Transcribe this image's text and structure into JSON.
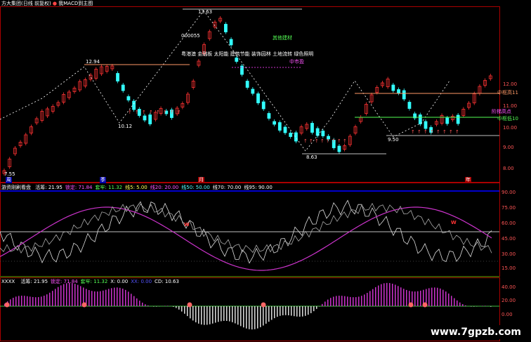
{
  "title_bar": {
    "main_title": "方大集团(日线 前复权)",
    "indicator_title": "我MACD到主图"
  },
  "main_chart": {
    "price_labels": {
      "high_label": "13.63",
      "left_high": "12.94",
      "low_left": "10.12",
      "low_mid": "8.63",
      "low_right": "9.50",
      "min_left": "7.55",
      "code_label": "000055"
    },
    "annotations": {
      "sector_name": "其他建材",
      "concepts": "粤港澳 金融板 太阳能 建筑节能 装饰园林 土地流转 绿色照明",
      "center_line": "中市盈",
      "right_top": "中枢高11",
      "right_mid": "中枢低10",
      "right_pink": "阶梯高点"
    },
    "y_axis": [
      "12.00",
      "11.00",
      "10.00",
      "9.00",
      "8.00"
    ],
    "bottom_markers": [
      "周",
      "季",
      "月",
      "年"
    ]
  },
  "mid_panel": {
    "name": "游资刚刷看盘",
    "items": [
      {
        "label": "活筹: 21.95",
        "color": "#ffffff"
      },
      {
        "label": "锁定: 71.84",
        "color": "#ff55ff"
      },
      {
        "label": "套牢: 11.32",
        "color": "#55ff55"
      },
      {
        "label": "线5: 5.00",
        "color": "#ffff55"
      },
      {
        "label": "线20: 20.00",
        "color": "#ff55ff"
      },
      {
        "label": "线50: 50.00",
        "color": "#55ffff"
      },
      {
        "label": "线70: 70.00",
        "color": "#ffffff"
      },
      {
        "label": "线95: 90.00",
        "color": "#ffffff"
      }
    ],
    "y_axis": [
      "90.00",
      "75.00",
      "60.00",
      "45.00",
      "30.00",
      "15.00"
    ],
    "mark": "W"
  },
  "bottom_panel": {
    "name": "XXXX",
    "items": [
      {
        "label": "活筹: 21.95",
        "color": "#ffffff"
      },
      {
        "label": "锁定: 71.84",
        "color": "#ff55ff"
      },
      {
        "label": "套牢: 11.32",
        "color": "#55ff55"
      },
      {
        "label": "X: 0.00",
        "color": "#ffffff"
      },
      {
        "label": "XX: 0.00",
        "color": "#5555ff"
      },
      {
        "label": "CD: 10.63",
        "color": "#ffffff"
      }
    ],
    "y_axis": [
      "40.00",
      "20.00",
      "0.00"
    ]
  },
  "watermark": "www.7gpzb.com",
  "colors": {
    "up": "#ff3333",
    "down": "#33ffff",
    "purple": "#cc33cc",
    "orange": "#ff9966",
    "border": "#aa0000"
  }
}
